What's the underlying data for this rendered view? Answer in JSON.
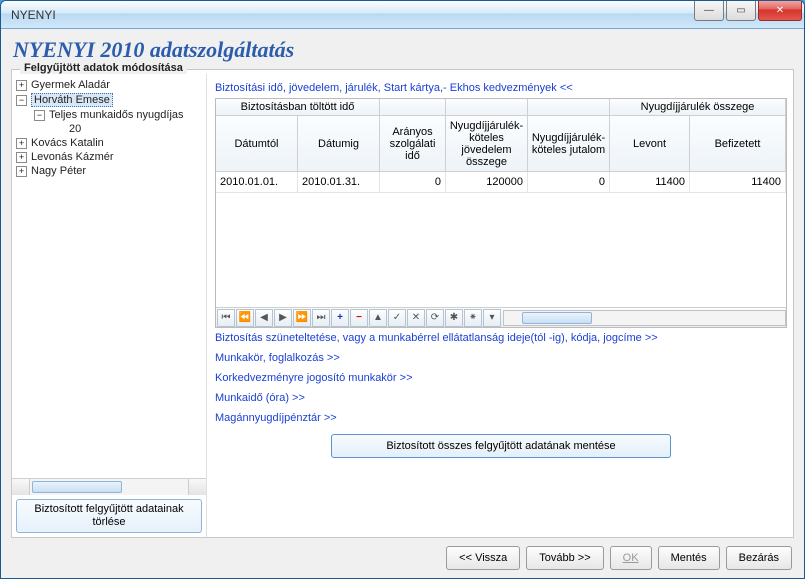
{
  "window": {
    "title": "NYENYI"
  },
  "app_title": "NYENYI 2010 adatszolgáltatás",
  "panel_title": "Felgyűjtött adatok módosítása",
  "tree": {
    "items": [
      {
        "label": "Gyermek Aladár",
        "exp": "+"
      },
      {
        "label": "Horváth Emese",
        "exp": "−",
        "selected": true
      },
      {
        "label": "Teljes munkaidős nyugdíjas",
        "exp": "−",
        "indent": 1
      },
      {
        "label": "20",
        "indent": 2
      },
      {
        "label": "Kovács Katalin",
        "exp": "+"
      },
      {
        "label": "Levonás Kázmér",
        "exp": "+"
      },
      {
        "label": "Nagy Péter",
        "exp": "+"
      }
    ]
  },
  "delete_btn": "Biztosított felgyűjtött adatainak törlése",
  "links": {
    "top": "Biztosítási idő, jövedelem, járulék, Start kártya,- Ekhos kedvezmények <<",
    "l1": "Biztosítás szüneteltetése, vagy a munkabérrel ellátatlanság ideje(tól -ig), kódja, jogcíme >>",
    "l2": "Munkakör, foglalkozás >>",
    "l3": "Korkedvezményre jogosító munkakör >>",
    "l4": "Munkaidő (óra) >>",
    "l5": "Magánnyugdíjpénztár >>"
  },
  "grid": {
    "group1": "Biztosításban töltött idő",
    "group2": "Nyugdíjjárulék összege",
    "h": {
      "c1": "Dátumtól",
      "c2": "Dátumig",
      "c3": "Arányos szolgálati idő",
      "c4": "Nyugdíjjárulék-köteles jövedelem összege",
      "c5": "Nyugdíjjárulék-köteles jutalom",
      "c6": "Levont",
      "c7": "Befizetett"
    },
    "row": {
      "c1": "2010.01.01.",
      "c2": "2010.01.31.",
      "c3": "0",
      "c4": "120000",
      "c5": "0",
      "c6": "11400",
      "c7": "11400"
    }
  },
  "save_all": "Biztosított összes felgyűjtött adatának mentése",
  "footer": {
    "back": "<< Vissza",
    "next": "Tovább >>",
    "ok": "OK",
    "save": "Mentés",
    "close": "Bezárás"
  }
}
